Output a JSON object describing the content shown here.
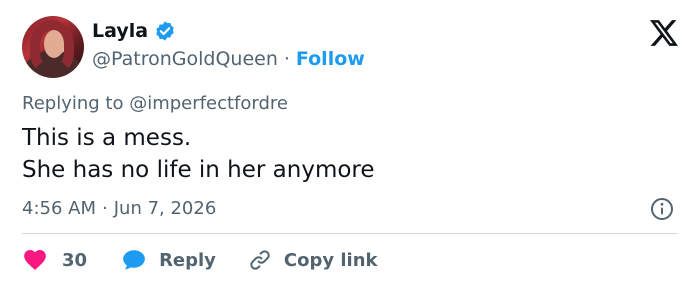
{
  "author": {
    "display_name": "Layla",
    "handle": "@PatronGoldQueen",
    "separator": "·",
    "follow_label": "Follow",
    "verified": true
  },
  "platform_logo": "x-logo-icon",
  "reply_context": {
    "prefix": "Replying to",
    "mention": "@imperfectfordre"
  },
  "tweet": {
    "lines": [
      "This is a mess.",
      "She has no life in her anymore"
    ]
  },
  "meta": {
    "time": "4:56 AM",
    "separator": "·",
    "date": "Jun 7, 2026"
  },
  "actions": {
    "like_count": "30",
    "reply_label": "Reply",
    "copy_link_label": "Copy link"
  },
  "colors": {
    "accent": "#1d9bf0",
    "like": "#f91880",
    "secondary_text": "#536471",
    "primary_text": "#0f1419",
    "divider": "#cfd9de"
  }
}
